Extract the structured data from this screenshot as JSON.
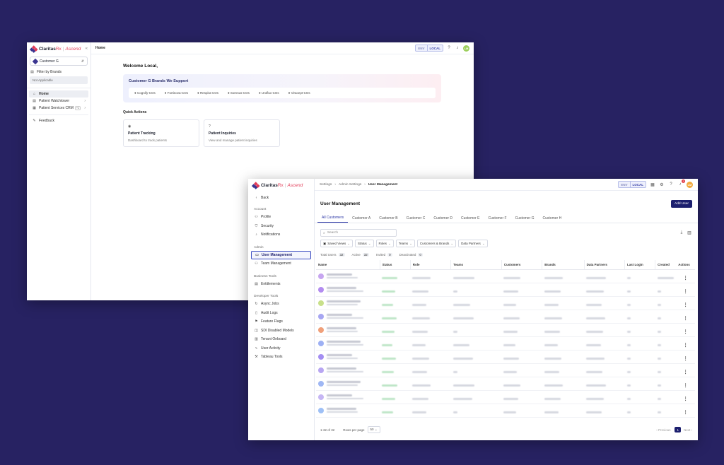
{
  "w1": {
    "logo": {
      "brand": "Claritas",
      "brand_suffix": "Rx",
      "product": "Ascend"
    },
    "collapse_icon": "«",
    "customer_select": {
      "value": "Customer G"
    },
    "filter_label": "Filter by Brands",
    "filter_value": "Not Applicable",
    "nav": [
      {
        "label": "Home",
        "icon": "home-icon",
        "glyph": "⌂"
      },
      {
        "label": "Patient Watchtower",
        "icon": "list-icon",
        "glyph": "▤"
      },
      {
        "label": "Patient Services CRM",
        "badge": "+1",
        "icon": "grid-icon",
        "glyph": "▦"
      },
      {
        "label": "Feedback",
        "icon": "feedback-icon",
        "glyph": "✎"
      }
    ],
    "breadcrumb": "Home",
    "env": {
      "label": "ENV",
      "value": "LOCAL"
    },
    "avatar_initials": "LM",
    "welcome": "Welcome Local,",
    "brands_title": "Customer G Brands We Support",
    "brands": [
      "Cognify-COs",
      "Fortinova-COs",
      "Respira-COs",
      "Somnus-COs",
      "Uroflux-COs",
      "Viracept-COs"
    ],
    "quick_actions_title": "Quick Actions",
    "cards": [
      {
        "title": "Patient Tracking",
        "desc": "Dashboard to track patients",
        "icon": "eye-icon",
        "glyph": "◉"
      },
      {
        "title": "Patient Inquiries",
        "desc": "View and manage patient inquiries",
        "icon": "help-icon",
        "glyph": "?"
      }
    ]
  },
  "w2": {
    "logo": {
      "brand": "Claritas",
      "brand_suffix": "Rx",
      "product": "Ascend"
    },
    "back": "Back",
    "sections": [
      {
        "title": "Account",
        "items": [
          {
            "label": "Profile",
            "icon": "user-icon",
            "glyph": "⚇"
          },
          {
            "label": "Security",
            "icon": "shield-icon",
            "glyph": "⛉"
          },
          {
            "label": "Notifications",
            "icon": "bell-icon",
            "glyph": "♪"
          }
        ]
      },
      {
        "title": "Admin",
        "items": [
          {
            "label": "User Management",
            "icon": "id-card-icon",
            "glyph": "▭",
            "active": true
          },
          {
            "label": "Team Management",
            "icon": "team-icon",
            "glyph": "⚇"
          }
        ]
      },
      {
        "title": "Business Tools",
        "items": [
          {
            "label": "Entitlements",
            "icon": "entitlement-icon",
            "glyph": "▤"
          }
        ]
      },
      {
        "title": "Developer Tools",
        "items": [
          {
            "label": "Async Jobs",
            "icon": "refresh-icon",
            "glyph": "↻"
          },
          {
            "label": "Audit Logs",
            "icon": "file-icon",
            "glyph": "▯"
          },
          {
            "label": "Feature Flags",
            "icon": "flag-icon",
            "glyph": "⚑"
          },
          {
            "label": "SDI Disabled Models",
            "icon": "database-icon",
            "glyph": "◫"
          },
          {
            "label": "Tenant Onboard",
            "icon": "building-icon",
            "glyph": "▥"
          },
          {
            "label": "User Activity",
            "icon": "activity-icon",
            "glyph": "∿"
          },
          {
            "label": "Tableau Tools",
            "icon": "tools-icon",
            "glyph": "⚒"
          }
        ]
      }
    ],
    "breadcrumbs": [
      "Settings",
      "Admin Settings",
      "User Management"
    ],
    "env": {
      "label": "ENV",
      "value": "LOCAL"
    },
    "notification_count": "3",
    "avatar_initials": "LM",
    "page_title": "User Management",
    "add_user": "Add User",
    "tabs": [
      "All Customers",
      "Customer A",
      "Customer B",
      "Customer C",
      "Customer D",
      "Customer E",
      "Customer F",
      "Customer G",
      "Customer H"
    ],
    "search_placeholder": "Search",
    "filters": [
      "Saved Views",
      "Status",
      "Roles",
      "Teams",
      "Customers & Brands",
      "Data Partners"
    ],
    "stats": [
      {
        "label": "Total Users",
        "value": "32"
      },
      {
        "label": "Active",
        "value": "32"
      },
      {
        "label": "Invited",
        "value": "0"
      },
      {
        "label": "Deactivated",
        "value": "0"
      }
    ],
    "columns": [
      "Name",
      "Status",
      "Role",
      "Teams",
      "Customers",
      "Brands",
      "Data Partners",
      "Last Login",
      "Created",
      "Actions"
    ],
    "rows": [
      {
        "avatar": "#c7a6f0"
      },
      {
        "avatar": "#b38cf0"
      },
      {
        "avatar": "#c8e08a"
      },
      {
        "avatar": "#a7a6f2"
      },
      {
        "avatar": "#f0a07a"
      },
      {
        "avatar": "#9db0f4"
      },
      {
        "avatar": "#a48ef2"
      },
      {
        "avatar": "#b8a6f2"
      },
      {
        "avatar": "#9fb7f4"
      },
      {
        "avatar": "#c6b6f4"
      },
      {
        "avatar": "#9ec0f6"
      }
    ],
    "pagination": {
      "range": "1-32 of 32",
      "rows_label": "Rows per page",
      "rows_value": "50",
      "prev": "Previous",
      "page": "1",
      "next": "Next"
    }
  },
  "colors": {
    "background": "#272262",
    "primary": "#1c1f6e",
    "accent_red": "#e23b57"
  }
}
